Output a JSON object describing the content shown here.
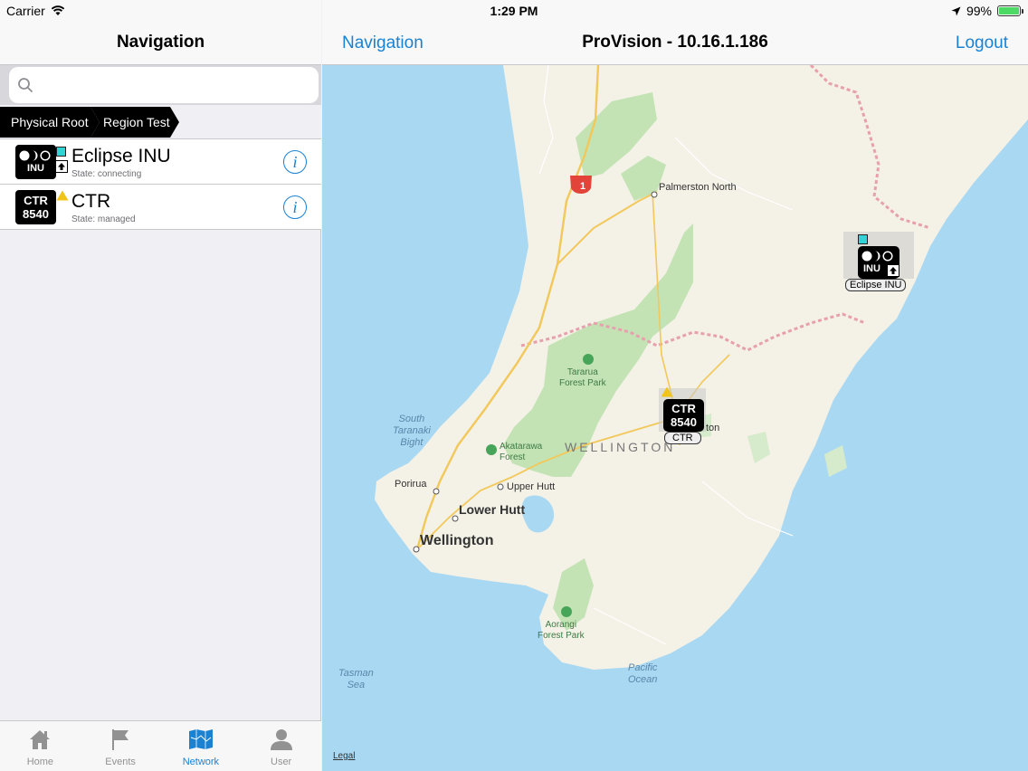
{
  "status_bar": {
    "carrier": "Carrier",
    "time": "1:29 PM",
    "battery": "99%"
  },
  "left_nav": {
    "title": "Navigation"
  },
  "search": {
    "placeholder": "",
    "value": ""
  },
  "breadcrumb": [
    "Physical Root",
    "Region Test"
  ],
  "devices": [
    {
      "name": "Eclipse INU",
      "state": "State: connecting",
      "icon_text": "INU",
      "status": "cyan-square"
    },
    {
      "name": "CTR",
      "state": "State: managed",
      "icon_text_top": "CTR",
      "icon_text_bottom": "8540",
      "status": "warning-triangle"
    }
  ],
  "tabs": [
    {
      "label": "Home",
      "icon": "home-icon",
      "active": false
    },
    {
      "label": "Events",
      "icon": "flag-icon",
      "active": false
    },
    {
      "label": "Network",
      "icon": "map-icon",
      "active": true
    },
    {
      "label": "User",
      "icon": "user-icon",
      "active": false
    }
  ],
  "right_nav": {
    "back": "Navigation",
    "title": "ProVision - 10.16.1.186",
    "logout": "Logout"
  },
  "map": {
    "labels": {
      "palmerston": "Palmerston North",
      "tararua": "Tararua\nForest Park",
      "south_taranaki": "South\nTaranaki\nBight",
      "wellington_region": "WELLINGTON",
      "akatarawa": "Akatarawa\nForest",
      "porirua": "Porirua",
      "upper_hutt": "Upper Hutt",
      "lower_hutt": "Lower Hutt",
      "wellington": "Wellington",
      "aorangi": "Aorangi\nForest Park",
      "pacific": "Pacific\nOcean",
      "tasman": "Tasman\nSea",
      "masterton_fragment": "ton",
      "highway": "1"
    },
    "legal": "Legal",
    "markers": {
      "eclipse": {
        "label": "Eclipse INU",
        "icon_text": "INU"
      },
      "ctr": {
        "label": "CTR",
        "icon_text_top": "CTR",
        "icon_text_bottom": "8540"
      }
    }
  },
  "colors": {
    "accent": "#1a82d3",
    "land": "#f4f1e6",
    "water": "#a9d8f3",
    "forest": "#c4e3b5",
    "status_cyan": "#2fd5d5",
    "warning": "#f0c419"
  }
}
